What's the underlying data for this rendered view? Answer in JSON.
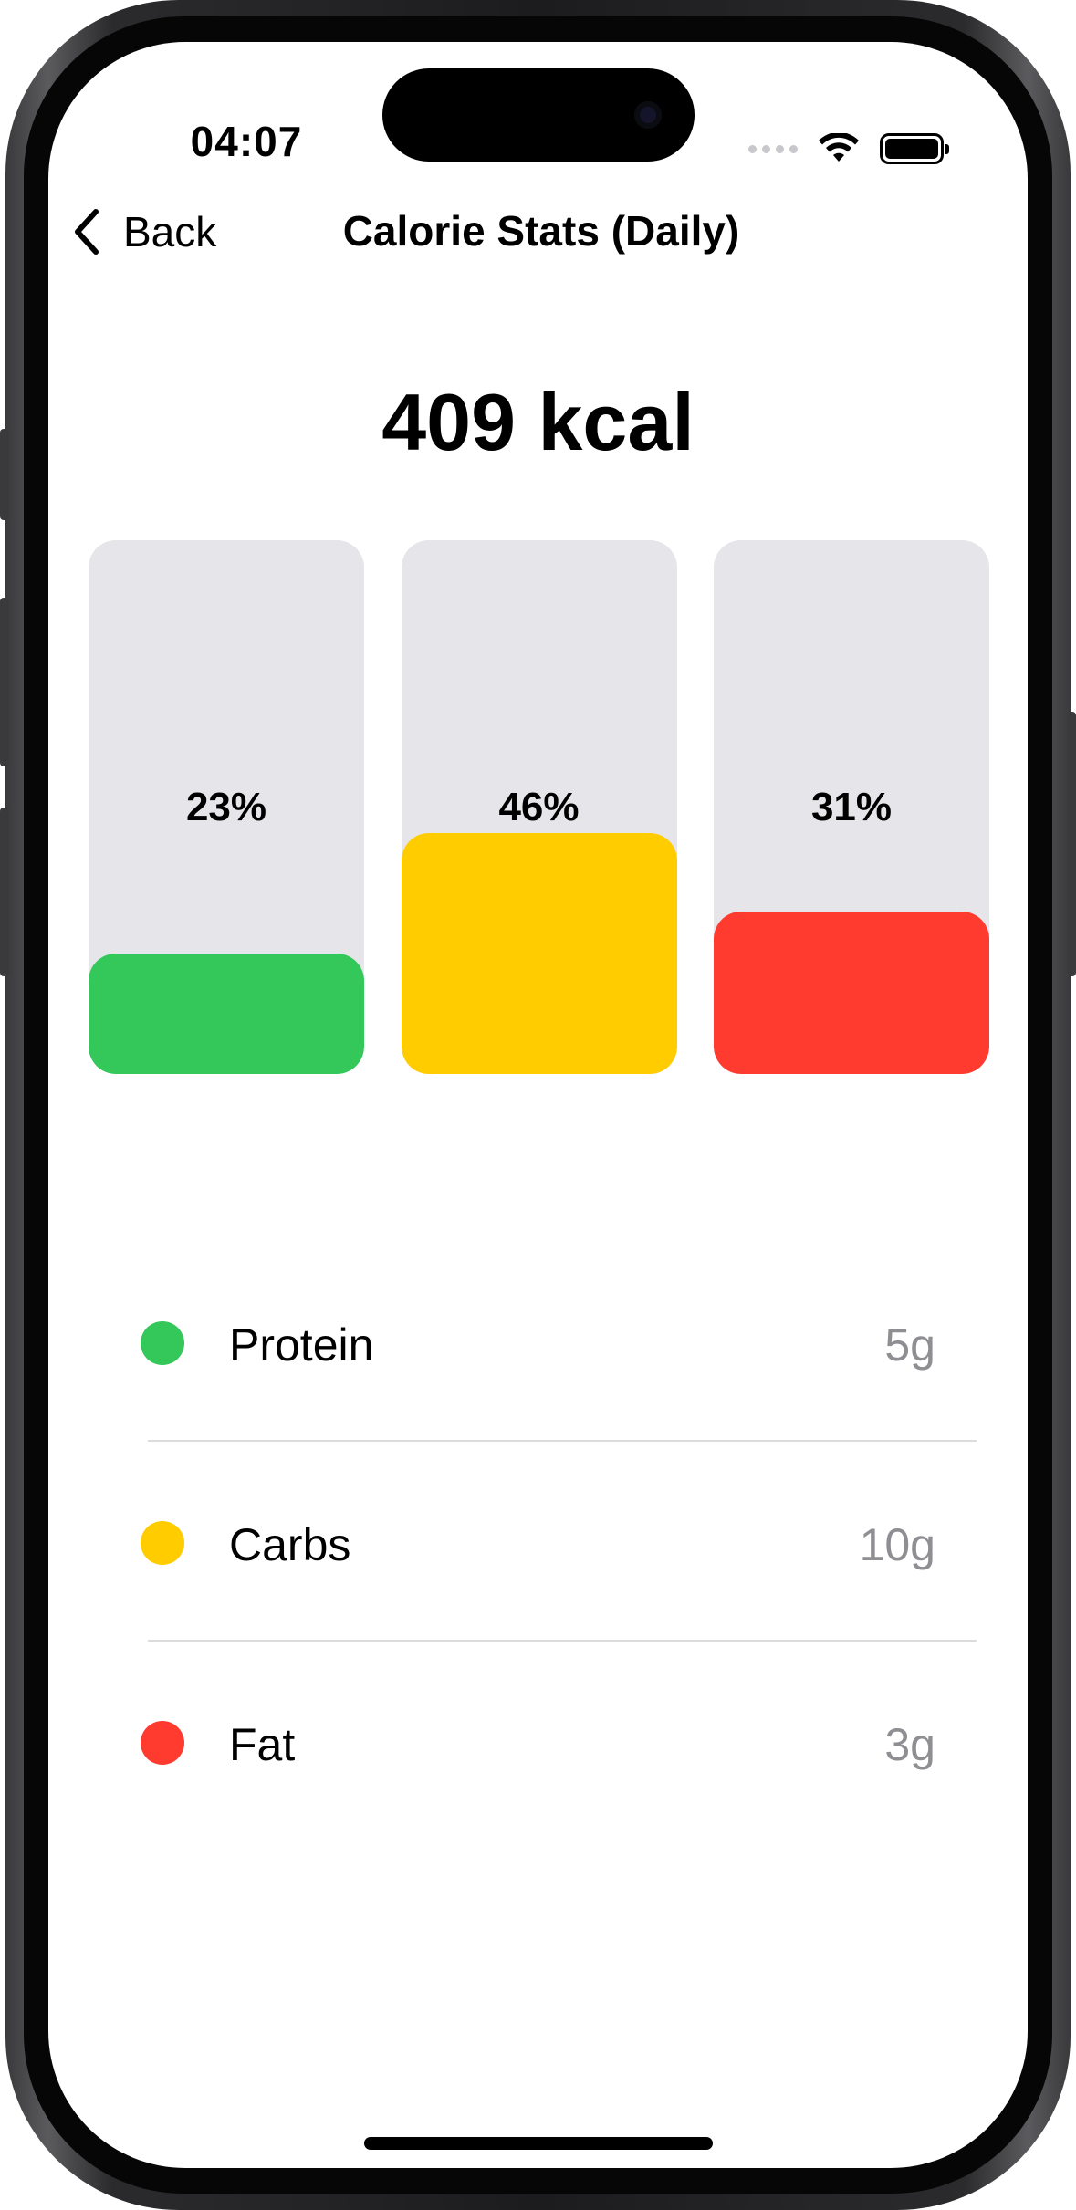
{
  "status_bar": {
    "time": "04:07"
  },
  "nav": {
    "back_label": "Back",
    "title": "Calorie Stats (Daily)"
  },
  "summary": {
    "total": "409 kcal"
  },
  "bars": [
    {
      "label": "23%",
      "fraction": 0.23,
      "color": "#34C759"
    },
    {
      "label": "46%",
      "fraction": 0.46,
      "color": "#FFCC00"
    },
    {
      "label": "31%",
      "fraction": 0.31,
      "color": "#FF3B30"
    }
  ],
  "macros": [
    {
      "name": "Protein",
      "amount": "5g",
      "color": "#34C759"
    },
    {
      "name": "Carbs",
      "amount": "10g",
      "color": "#FFCC00"
    },
    {
      "name": "Fat",
      "amount": "3g",
      "color": "#FF3B30"
    }
  ],
  "colors": {
    "bar_track": "#E5E5EA",
    "secondary_text": "#8E8E93"
  },
  "icons": {
    "back": "chevron-left-icon",
    "wifi": "wifi-icon",
    "battery": "battery-icon",
    "signal": "signal-icon"
  }
}
